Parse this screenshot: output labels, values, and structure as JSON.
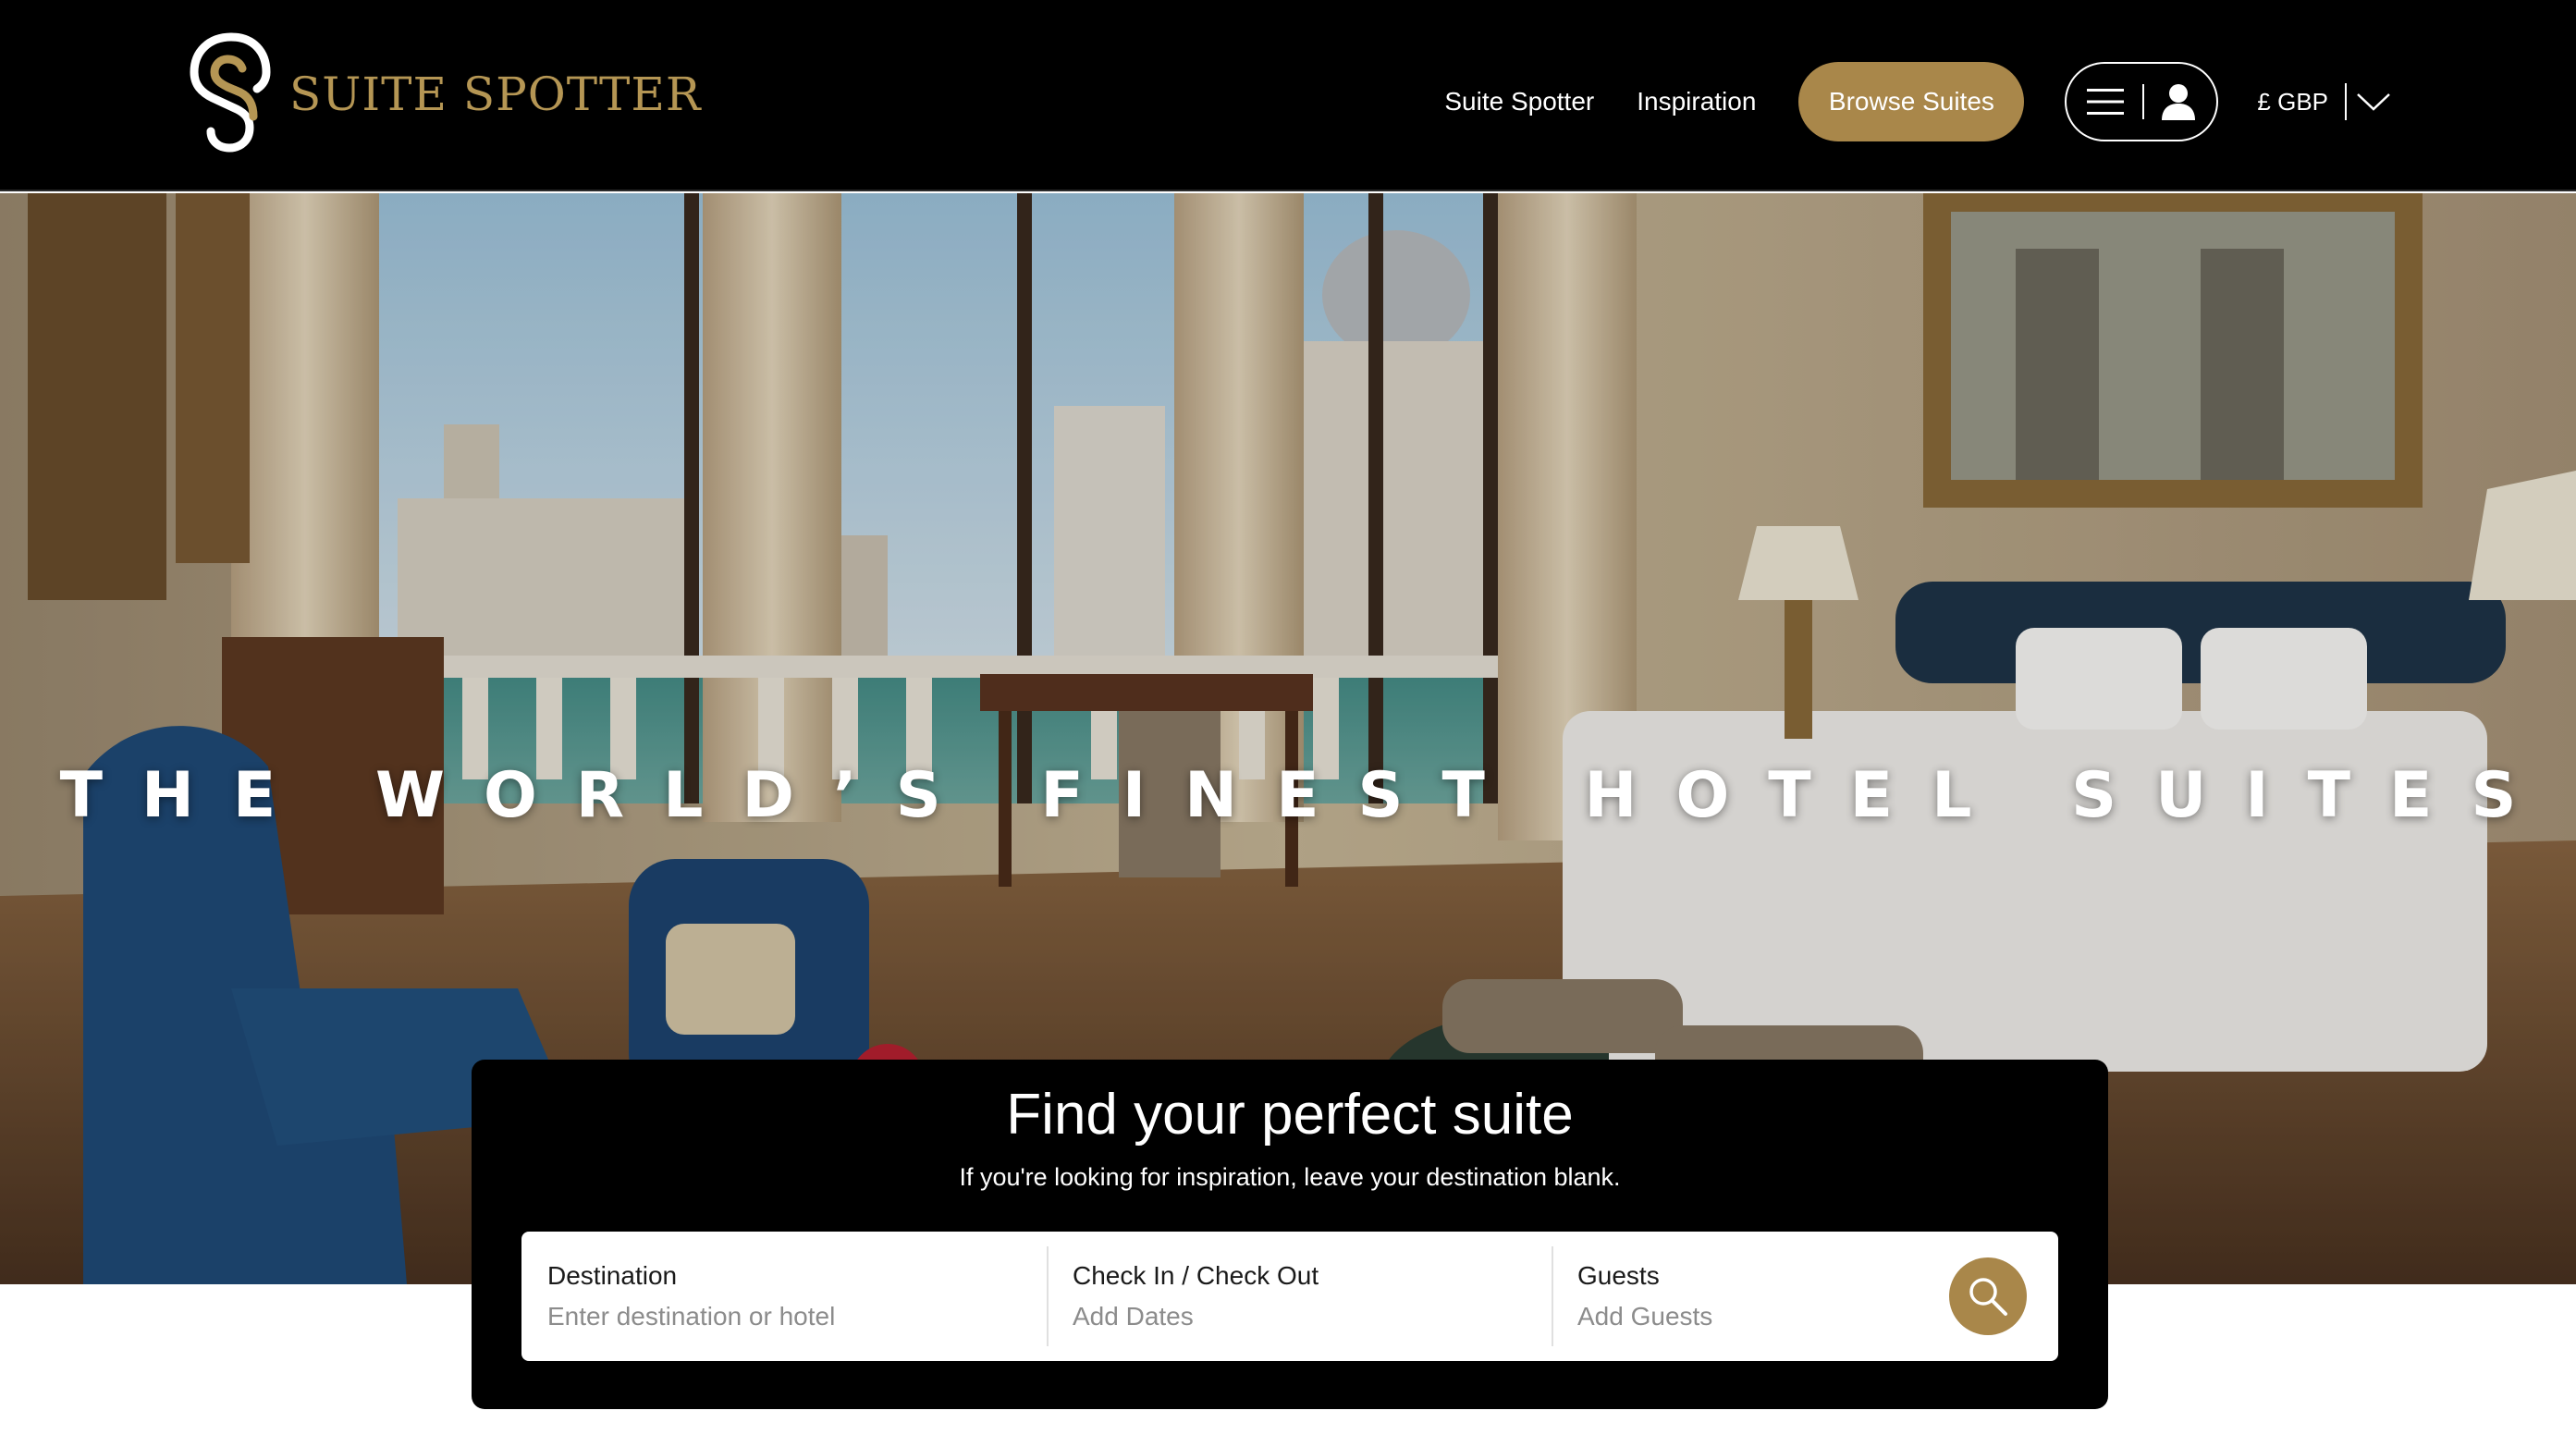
{
  "brand": {
    "name": "SUITE SPOTTER",
    "logo_icon": "suite-spotter-logo-icon",
    "gold": "#a9874a",
    "gold_text": "#b59654"
  },
  "nav": {
    "links": [
      {
        "label": "Suite Spotter"
      },
      {
        "label": "Inspiration"
      }
    ],
    "browse_label": "Browse Suites",
    "menu_icon": "hamburger-icon",
    "account_icon": "user-icon",
    "currency_label": "£ GBP",
    "currency_icon": "chevron-down-icon"
  },
  "hero": {
    "title": "THE WORLD’S FINEST HOTEL SUITES"
  },
  "search": {
    "title": "Find your perfect suite",
    "subtitle": "If you're looking for inspiration, leave your destination blank.",
    "fields": [
      {
        "label": "Destination",
        "placeholder": "Enter destination or hotel"
      },
      {
        "label": "Check In / Check Out",
        "placeholder": "Add Dates"
      },
      {
        "label": "Guests",
        "placeholder": "Add Guests"
      }
    ],
    "button_icon": "search-icon"
  }
}
